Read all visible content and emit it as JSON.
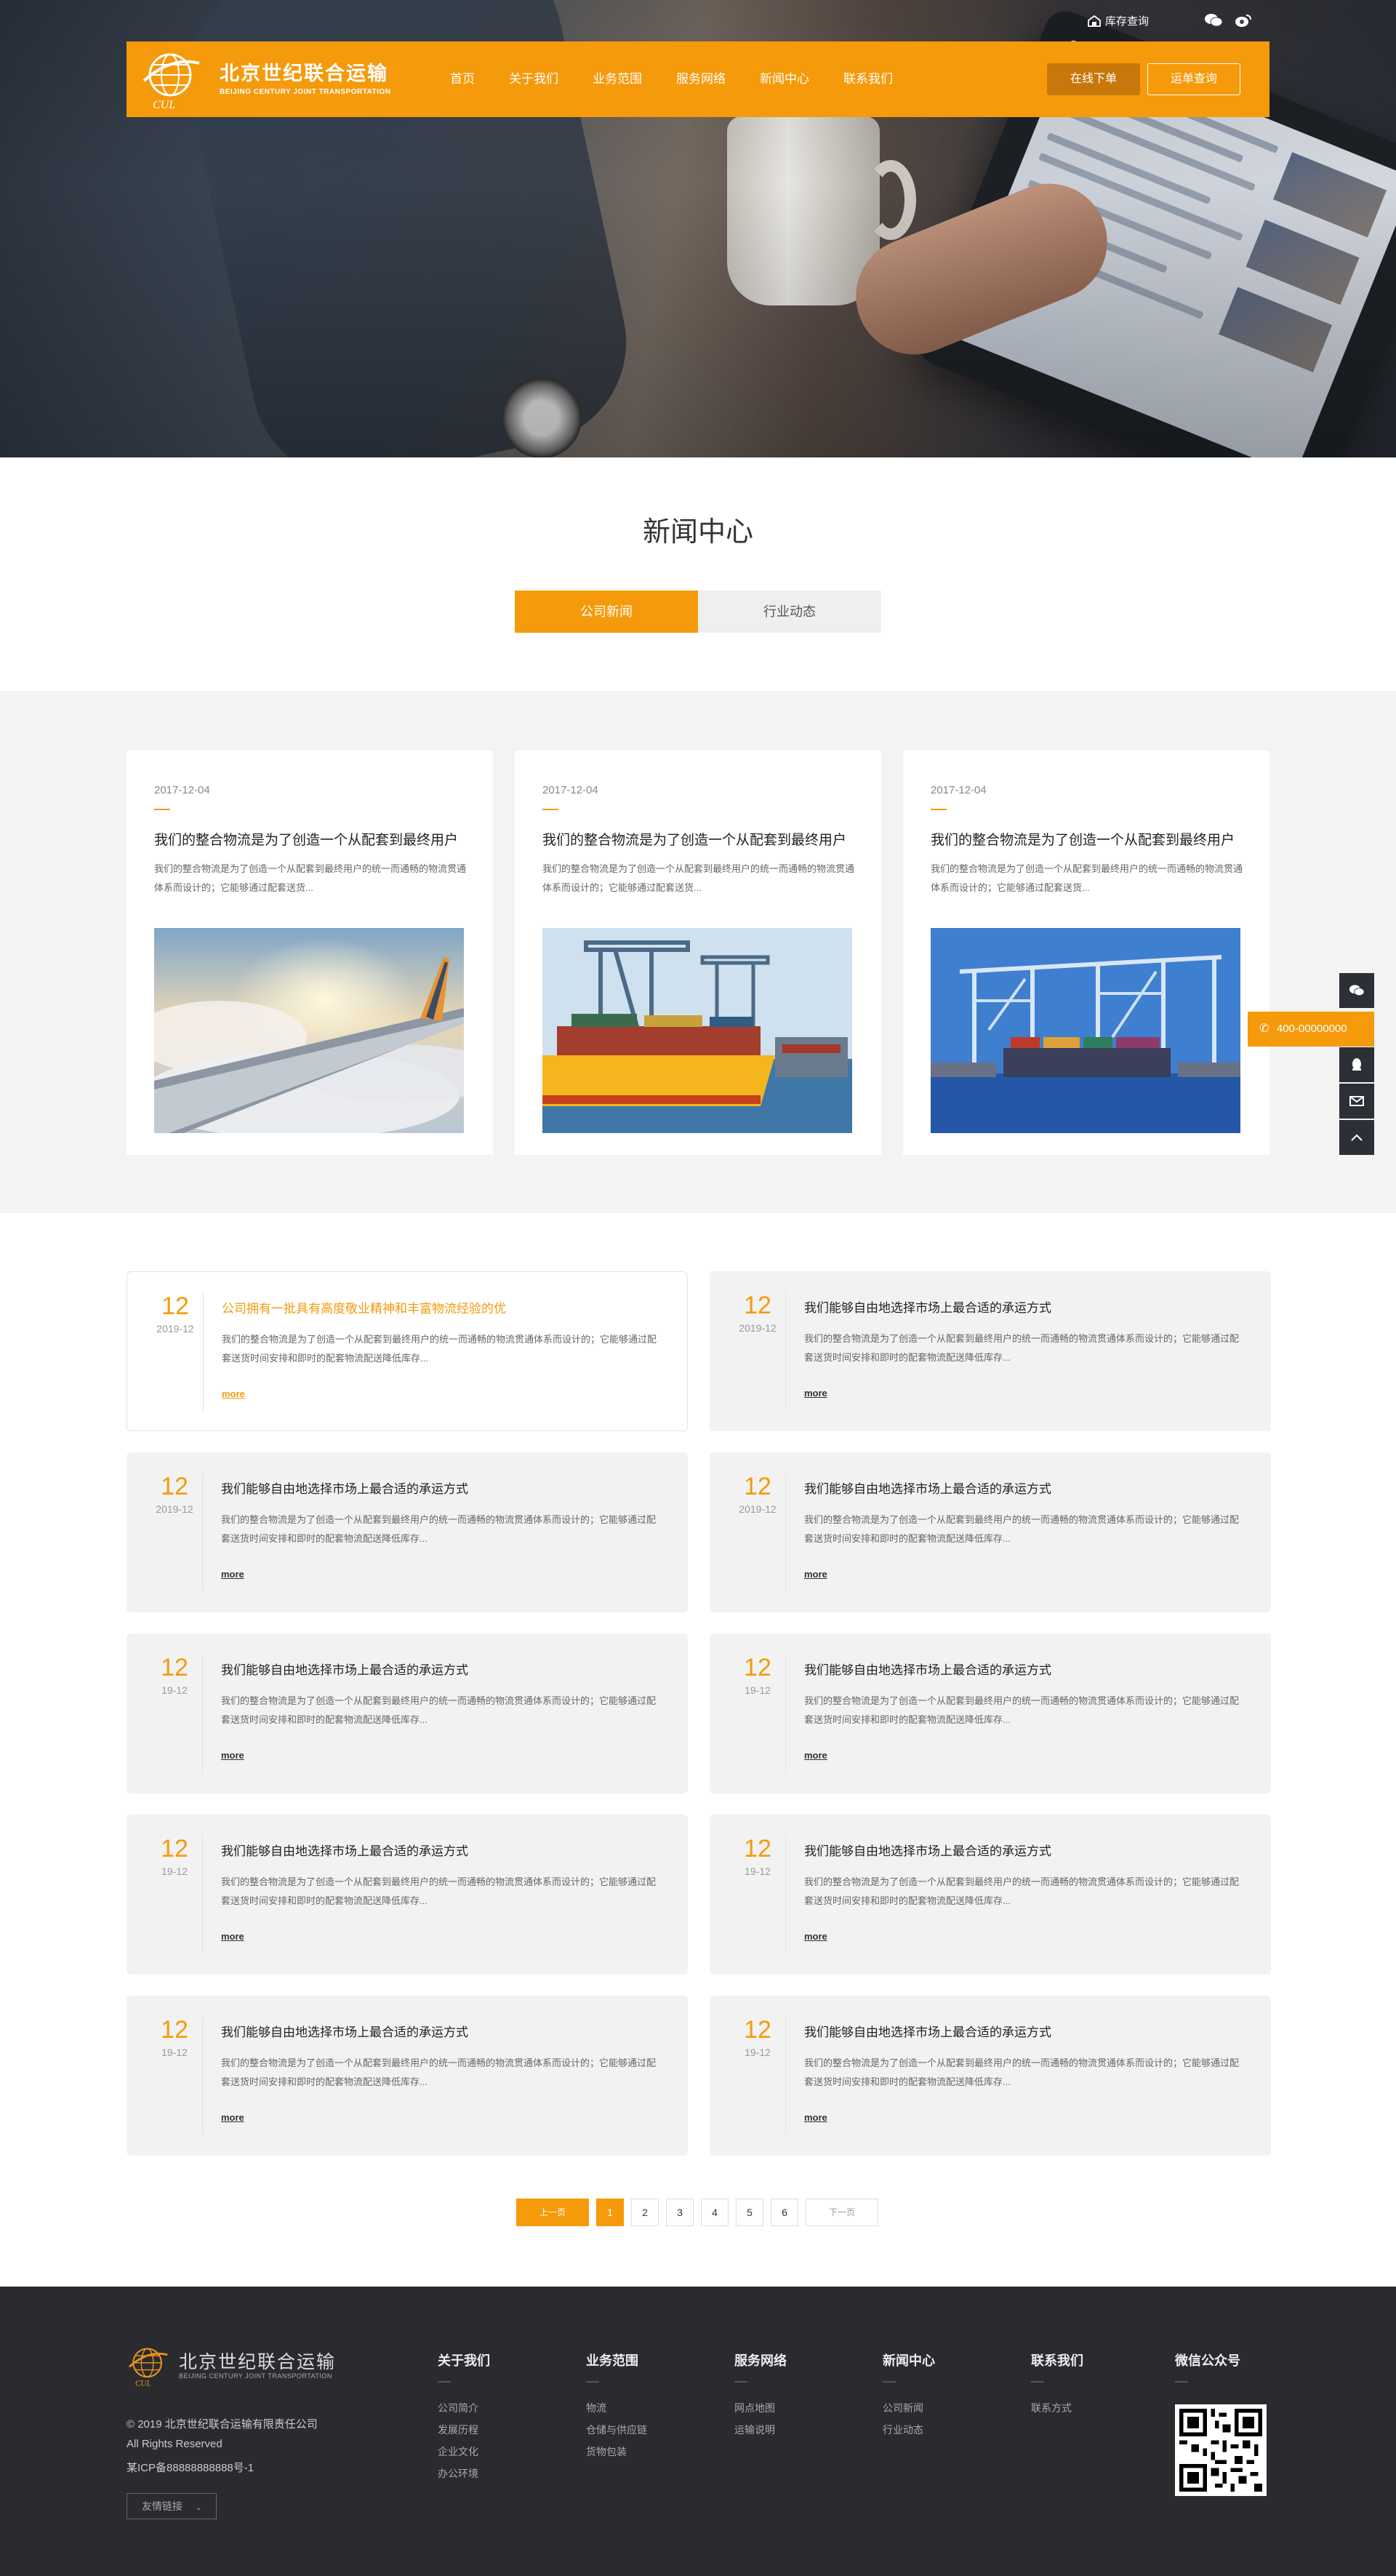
{
  "colors": {
    "accent": "#f59a0b",
    "footer_bg": "#2a2b2f",
    "band_bg": "#f3f3f3"
  },
  "topbar": {
    "stock_query": "库存查询",
    "wechat_icon": "wechat-icon",
    "weibo_icon": "weibo-icon"
  },
  "header": {
    "brand_cn": "北京世纪联合运输",
    "brand_en": "BEIJING CENTURY JOINT TRANSPORTATION",
    "logo_letters": "CUL",
    "menu": [
      "首页",
      "关于我们",
      "业务范围",
      "服务网络",
      "新闻中心",
      "联系我们"
    ],
    "btn_order": "在线下单",
    "btn_track": "运单查询"
  },
  "section": {
    "title": "新闻中心",
    "tabs": [
      "公司新闻",
      "行业动态"
    ],
    "active_tab": 0
  },
  "featured": [
    {
      "date": "2017-12-04",
      "title": "我们的整合物流是为了创造一个从配套到最终用户",
      "desc": "我们的整合物流是为了创造一个从配套到最终用户的统一而通畅的物流贯通体系而设计的；它能够通过配套送货...",
      "image": "airplane-wing-sky"
    },
    {
      "date": "2017-12-04",
      "title": "我们的整合物流是为了创造一个从配套到最终用户",
      "desc": "我们的整合物流是为了创造一个从配套到最终用户的统一而通畅的物流贯通体系而设计的；它能够通过配套送货...",
      "image": "cargo-ship-crane"
    },
    {
      "date": "2017-12-04",
      "title": "我们的整合物流是为了创造一个从配套到最终用户",
      "desc": "我们的整合物流是为了创造一个从配套到最终用户的统一而通畅的物流贯通体系而设计的；它能够通过配套送货...",
      "image": "container-port-cranes"
    }
  ],
  "news": [
    {
      "day": "12",
      "ym": "2019-12",
      "title": "公司拥有一批具有高度敬业精神和丰富物流经验的优",
      "desc": "我们的整合物流是为了创造一个从配套到最终用户的统一而通畅的物流贯通体系而设计的；它能够通过配套送货时间安排和即时的配套物流配送降低库存...",
      "more": "more",
      "highlight": true
    },
    {
      "day": "12",
      "ym": "2019-12",
      "title": "我们能够自由地选择市场上最合适的承运方式",
      "desc": "我们的整合物流是为了创造一个从配套到最终用户的统一而通畅的物流贯通体系而设计的；它能够通过配套送货时间安排和即时的配套物流配送降低库存...",
      "more": "more",
      "highlight": false
    },
    {
      "day": "12",
      "ym": "2019-12",
      "title": "我们能够自由地选择市场上最合适的承运方式",
      "desc": "我们的整合物流是为了创造一个从配套到最终用户的统一而通畅的物流贯通体系而设计的；它能够通过配套送货时间安排和即时的配套物流配送降低库存...",
      "more": "more",
      "highlight": false
    },
    {
      "day": "12",
      "ym": "2019-12",
      "title": "我们能够自由地选择市场上最合适的承运方式",
      "desc": "我们的整合物流是为了创造一个从配套到最终用户的统一而通畅的物流贯通体系而设计的；它能够通过配套送货时间安排和即时的配套物流配送降低库存...",
      "more": "more",
      "highlight": false
    },
    {
      "day": "12",
      "ym": "19-12",
      "title": "我们能够自由地选择市场上最合适的承运方式",
      "desc": "我们的整合物流是为了创造一个从配套到最终用户的统一而通畅的物流贯通体系而设计的；它能够通过配套送货时间安排和即时的配套物流配送降低库存...",
      "more": "more",
      "highlight": false
    },
    {
      "day": "12",
      "ym": "19-12",
      "title": "我们能够自由地选择市场上最合适的承运方式",
      "desc": "我们的整合物流是为了创造一个从配套到最终用户的统一而通畅的物流贯通体系而设计的；它能够通过配套送货时间安排和即时的配套物流配送降低库存...",
      "more": "more",
      "highlight": false
    },
    {
      "day": "12",
      "ym": "19-12",
      "title": "我们能够自由地选择市场上最合适的承运方式",
      "desc": "我们的整合物流是为了创造一个从配套到最终用户的统一而通畅的物流贯通体系而设计的；它能够通过配套送货时间安排和即时的配套物流配送降低库存...",
      "more": "more",
      "highlight": false
    },
    {
      "day": "12",
      "ym": "19-12",
      "title": "我们能够自由地选择市场上最合适的承运方式",
      "desc": "我们的整合物流是为了创造一个从配套到最终用户的统一而通畅的物流贯通体系而设计的；它能够通过配套送货时间安排和即时的配套物流配送降低库存...",
      "more": "more",
      "highlight": false
    },
    {
      "day": "12",
      "ym": "19-12",
      "title": "我们能够自由地选择市场上最合适的承运方式",
      "desc": "我们的整合物流是为了创造一个从配套到最终用户的统一而通畅的物流贯通体系而设计的；它能够通过配套送货时间安排和即时的配套物流配送降低库存...",
      "more": "more",
      "highlight": false
    },
    {
      "day": "12",
      "ym": "19-12",
      "title": "我们能够自由地选择市场上最合适的承运方式",
      "desc": "我们的整合物流是为了创造一个从配套到最终用户的统一而通畅的物流贯通体系而设计的；它能够通过配套送货时间安排和即时的配套物流配送降低库存...",
      "more": "more",
      "highlight": false
    }
  ],
  "pager": {
    "prev": "上一页",
    "pages": [
      "1",
      "2",
      "3",
      "4",
      "5",
      "6"
    ],
    "current": "1",
    "next": "下一页"
  },
  "side": {
    "phone": "400-00000000",
    "icons": [
      "wechat-icon",
      "phone-icon",
      "qq-icon",
      "mail-icon",
      "back-to-top-icon"
    ]
  },
  "footer": {
    "brand_cn": "北京世纪联合运输",
    "brand_en": "BEIJING CENTURY JOINT TRANSPORTATION",
    "logo_letters": "CUL",
    "copyright": "© 2019 北京世纪联合运输有限责任公司",
    "rights": "All Rights Reserved",
    "icp": "某ICP备88888888888号-1",
    "friend_links": "友情链接",
    "columns": [
      {
        "title": "关于我们",
        "links": [
          "公司简介",
          "发展历程",
          "企业文化",
          "办公环境"
        ]
      },
      {
        "title": "业务范围",
        "links": [
          "物流",
          "仓储与供应链",
          "货物包装"
        ]
      },
      {
        "title": "服务网络",
        "links": [
          "网点地图",
          "运输说明"
        ]
      },
      {
        "title": "新闻中心",
        "links": [
          "公司新闻",
          "行业动态"
        ]
      },
      {
        "title": "联系我们",
        "links": [
          "联系方式"
        ]
      }
    ],
    "wechat_title": "微信公众号"
  }
}
